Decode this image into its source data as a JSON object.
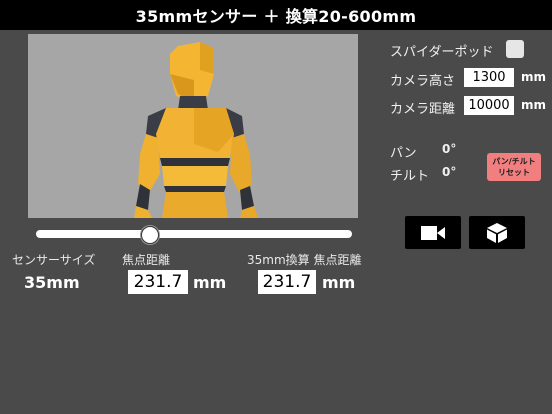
{
  "title": "35mmセンサー ＋ 換算20-600mm",
  "slider": {
    "fraction": 0.36
  },
  "sensor": {
    "label": "センサーサイズ",
    "value": "35mm"
  },
  "focal": {
    "label": "焦点距離",
    "value": "231.7",
    "unit": "mm"
  },
  "focal35": {
    "label": "35mm換算 焦点距離",
    "value": "231.7",
    "unit": "mm"
  },
  "tripod": {
    "label": "スパイダーポッド",
    "checked": false
  },
  "camera_height": {
    "label": "カメラ高さ",
    "value": "1300",
    "unit": "mm"
  },
  "camera_distance": {
    "label": "カメラ距離",
    "value": "10000",
    "unit": "mm"
  },
  "pan": {
    "label": "パン",
    "value": "0°"
  },
  "tilt": {
    "label": "チルト",
    "value": "0°"
  },
  "reset": {
    "line1": "パン/チルト",
    "line2": "リセット"
  },
  "icons": {
    "camera": "video-camera-icon",
    "cube": "cube-icon"
  },
  "colors": {
    "background": "#4a4a4a",
    "titlebar": "#000000",
    "reset": "#f27f7f",
    "figure": "#f2b233"
  }
}
